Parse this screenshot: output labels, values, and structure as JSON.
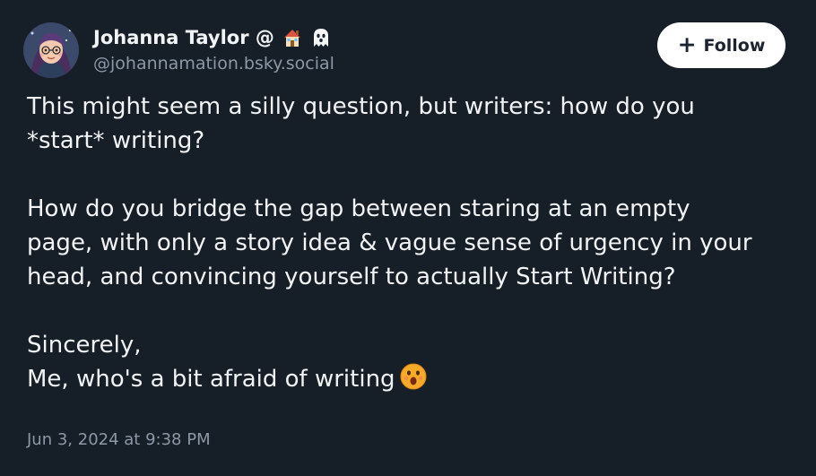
{
  "author": {
    "display_name": "Johanna Taylor @",
    "name_emojis": [
      "house-icon",
      "ghost-icon"
    ],
    "handle": "@johannamation.bsky.social",
    "avatar": "avatar-illustration"
  },
  "follow_button": {
    "label": "Follow",
    "icon": "plus-icon",
    "icon_glyph": "+"
  },
  "post": {
    "paragraphs": [
      [
        "This might seem a silly question, but writers: how do you",
        "*start* writing?"
      ],
      [
        "How do you bridge the gap between staring at an empty",
        "page, with only a story idea & vague sense of urgency in your",
        "head, and convincing yourself to actually Start Writing?"
      ],
      [
        "Sincerely,",
        "Me, who's a bit afraid of writing"
      ]
    ],
    "trailing_emoji": "face-with-open-mouth-icon",
    "timestamp": "Jun 3, 2024 at 9:38 PM"
  },
  "colors": {
    "background": "#161e27",
    "text": "#f1f3f5",
    "muted": "#8d98a7",
    "button_bg": "#ffffff",
    "button_text": "#1b2430"
  }
}
